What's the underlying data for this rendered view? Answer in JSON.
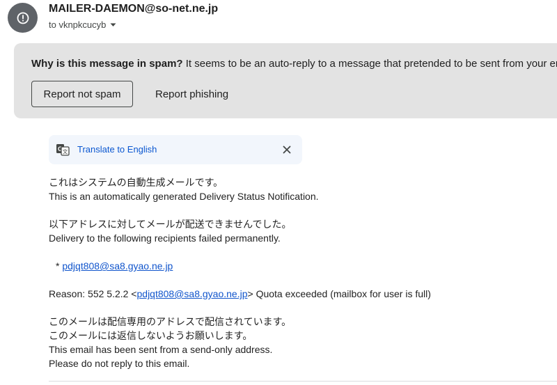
{
  "sender": {
    "name": "MAILER-DAEMON@so-net.ne.jp",
    "recipient_label": "to vknpkcucyb",
    "avatar_icon": "alert-circle-icon"
  },
  "spam_banner": {
    "question": "Why is this message in spam?",
    "explanation": "It seems to be an auto-reply to a message that pretended to be sent from your email",
    "report_not_spam_label": "Report not spam",
    "report_phishing_label": "Report phishing"
  },
  "translate": {
    "icon": "translate-icon",
    "link_label": "Translate to English",
    "close_icon": "close-icon"
  },
  "message": {
    "line1_ja": "これはシステムの自動生成メールです。",
    "line1_en": "This is an automatically generated Delivery Status Notification.",
    "line2_ja": "以下アドレスに対してメールが配送できませんでした。",
    "line2_en": "Delivery to the following recipients failed permanently.",
    "bullet": "*",
    "recipient_address": "pdjqt808@sa8.gyao.ne.jp",
    "reason_prefix": "Reason: 552 5.2.2 <",
    "reason_address": "pdjqt808@sa8.gyao.ne.jp",
    "reason_suffix": "> Quota exceeded (mailbox for user is full)",
    "footer_ja_1": "このメールは配信専用のアドレスで配信されています。",
    "footer_ja_2": "このメールには返信しないようお願いします。",
    "footer_en_1": "This email has been sent from a send-only address.",
    "footer_en_2": "Please do not reply to this email."
  },
  "colors": {
    "avatar_bg": "#5f6368",
    "banner_bg": "#e3e3e3",
    "translate_bg": "#f2f6fc",
    "link": "#1155cc",
    "translate_link": "#0b57d0"
  }
}
